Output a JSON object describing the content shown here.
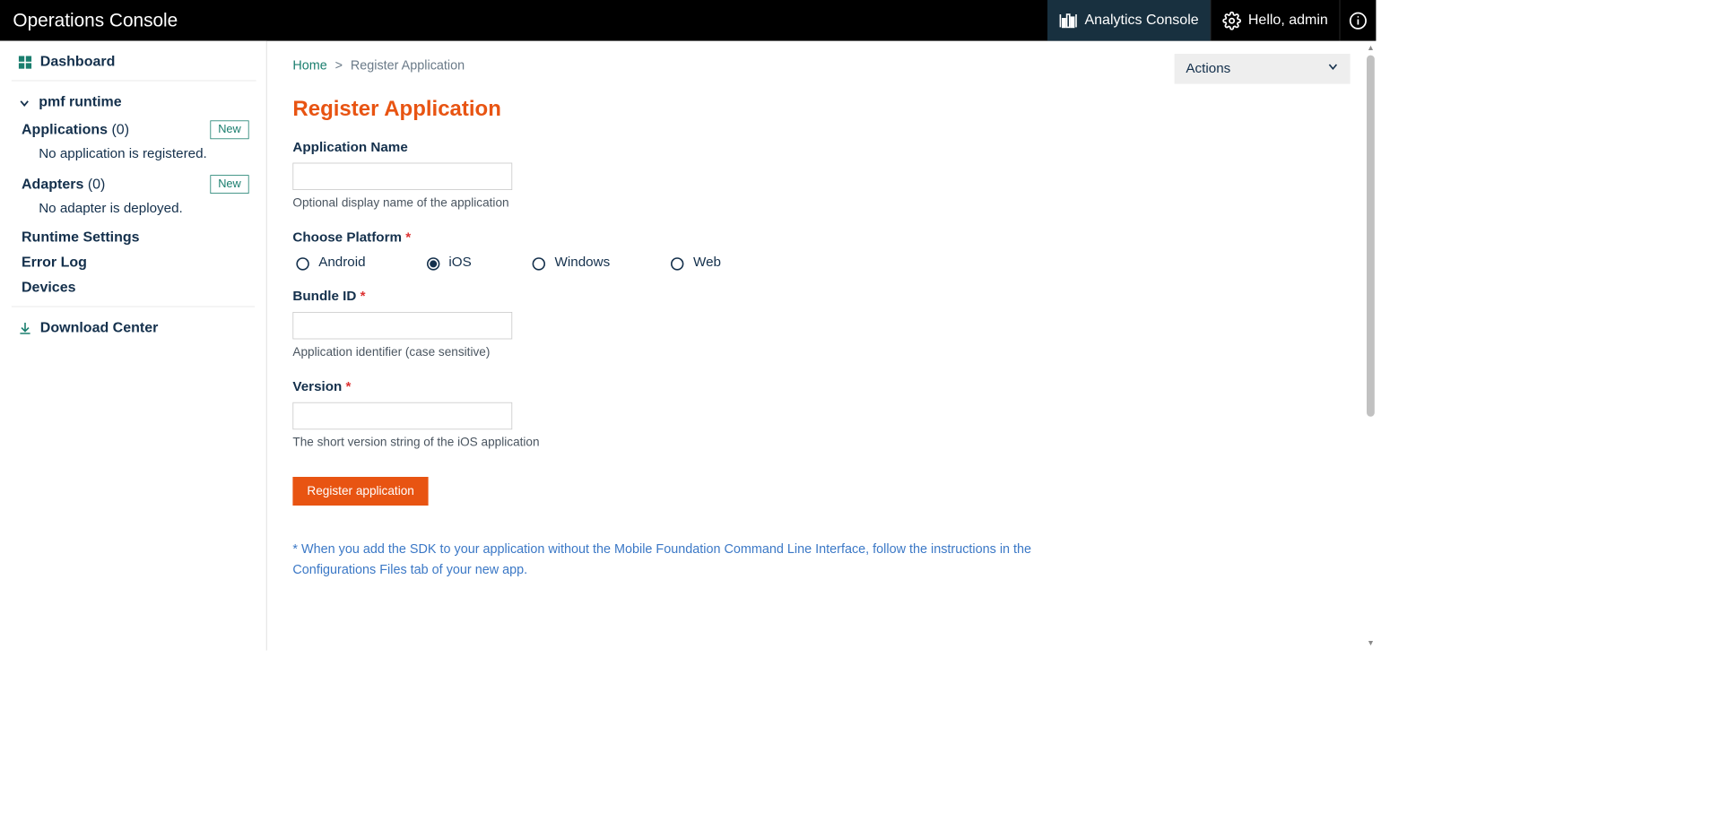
{
  "header": {
    "title": "Operations Console",
    "analytics": "Analytics Console",
    "hello": "Hello, admin"
  },
  "sidebar": {
    "dashboard": "Dashboard",
    "runtime_label": "pmf runtime",
    "applications_label": "Applications",
    "applications_count": "(0)",
    "applications_new": "New",
    "applications_empty": "No application is registered.",
    "adapters_label": "Adapters",
    "adapters_count": "(0)",
    "adapters_new": "New",
    "adapters_empty": "No adapter is deployed.",
    "runtime_settings": "Runtime Settings",
    "error_log": "Error Log",
    "devices": "Devices",
    "download_center": "Download Center"
  },
  "breadcrumb": {
    "home": "Home",
    "current": "Register Application"
  },
  "actions_label": "Actions",
  "page_title": "Register Application",
  "form": {
    "app_name_label": "Application Name",
    "app_name_help": "Optional display name of the application",
    "platform_label": "Choose Platform",
    "platform_options": {
      "android": "Android",
      "ios": "iOS",
      "windows": "Windows",
      "web": "Web"
    },
    "platform_selected": "ios",
    "bundle_label": "Bundle ID",
    "bundle_help": "Application identifier (case sensitive)",
    "version_label": "Version",
    "version_help": "The short version string of the iOS application",
    "submit_label": "Register application"
  },
  "footnote": "* When you add the SDK to your application without the Mobile Foundation Command Line Interface, follow the instructions in the Configurations Files tab of your new app."
}
